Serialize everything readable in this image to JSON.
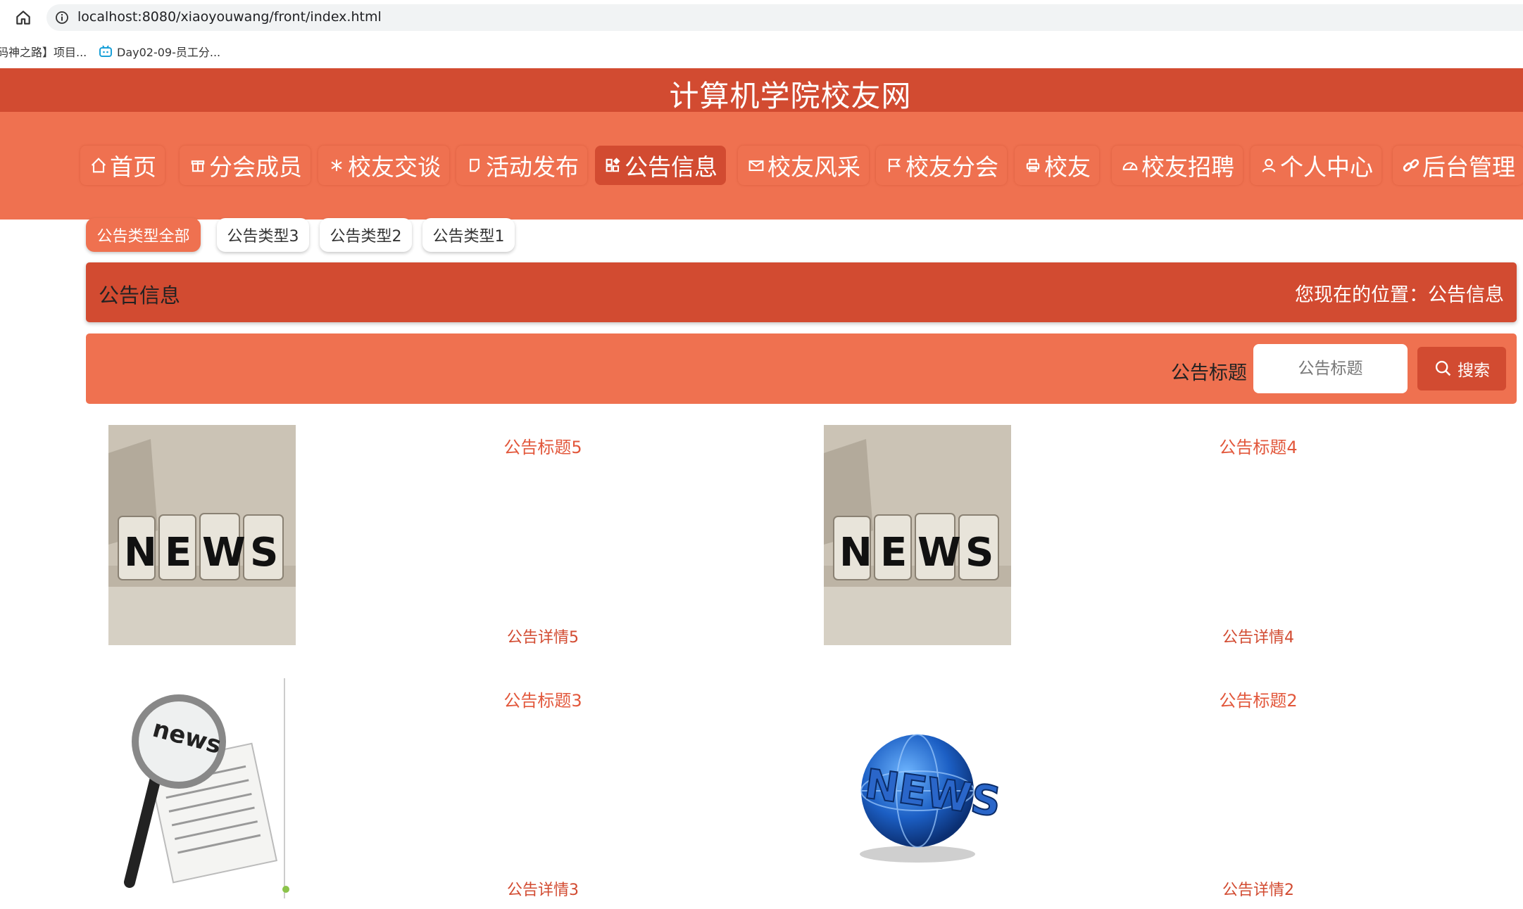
{
  "browser": {
    "url": "localhost:8080/xiaoyouwang/front/index.html",
    "bookmarks": [
      "码神之路】项目...",
      "Day02-09-员工分..."
    ]
  },
  "site": {
    "title": "计算机学院校友网"
  },
  "nav": {
    "items": [
      {
        "label": "首页",
        "icon": "home-icon"
      },
      {
        "label": "分会成员",
        "icon": "gift-icon"
      },
      {
        "label": "校友交谈",
        "icon": "snowflake-icon"
      },
      {
        "label": "活动发布",
        "icon": "note-icon"
      },
      {
        "label": "公告信息",
        "icon": "grid-icon",
        "active": true
      },
      {
        "label": "校友风采",
        "icon": "mail-icon"
      },
      {
        "label": "校友分会",
        "icon": "flag-icon"
      },
      {
        "label": "校友",
        "icon": "printer-icon"
      },
      {
        "label": "校友招聘",
        "icon": "gauge-icon"
      },
      {
        "label": "个人中心",
        "icon": "user-icon"
      },
      {
        "label": "后台管理",
        "icon": "link-icon"
      }
    ]
  },
  "types": [
    "公告类型全部",
    "公告类型3",
    "公告类型2",
    "公告类型1"
  ],
  "header": {
    "title": "公告信息",
    "breadcrumb": "您现在的位置：公告信息"
  },
  "search": {
    "label": "公告标题",
    "placeholder": "公告标题",
    "button": "搜索"
  },
  "notices": [
    {
      "title": "公告标题5",
      "detail": "公告详情5",
      "image": "news-blocks"
    },
    {
      "title": "公告标题4",
      "detail": "公告详情4",
      "image": "news-blocks"
    },
    {
      "title": "公告标题3",
      "detail": "公告详情3",
      "image": "news-magnifier"
    },
    {
      "title": "公告标题2",
      "detail": "公告详情2",
      "image": "news-globe"
    }
  ],
  "colors": {
    "dark": "#d24b31",
    "light": "#ef7150",
    "link": "#e2573b"
  }
}
